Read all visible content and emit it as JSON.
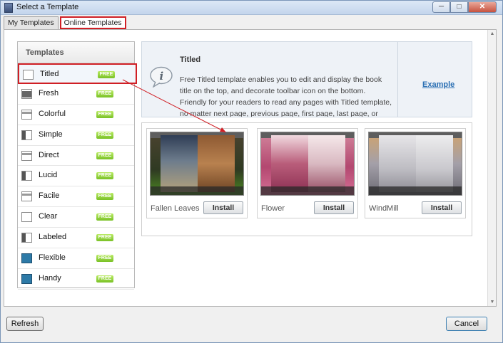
{
  "window": {
    "title": "Select a Template"
  },
  "window_controls": {
    "minimize": "─",
    "maximize": "□",
    "close": "✕"
  },
  "tabs": [
    {
      "label": "My Templates",
      "active": false
    },
    {
      "label": "Online Templates",
      "active": true
    }
  ],
  "sidebar": {
    "header": "Templates",
    "badge": "FREE",
    "items": [
      {
        "label": "Titled",
        "icon": "layout-icon",
        "selected": true
      },
      {
        "label": "Fresh",
        "icon": "layout-icon"
      },
      {
        "label": "Colorful",
        "icon": "layout-icon"
      },
      {
        "label": "Simple",
        "icon": "layout-icon"
      },
      {
        "label": "Direct",
        "icon": "layout-icon"
      },
      {
        "label": "Lucid",
        "icon": "layout-icon"
      },
      {
        "label": "Facile",
        "icon": "layout-icon"
      },
      {
        "label": "Clear",
        "icon": "layout-icon"
      },
      {
        "label": "Labeled",
        "icon": "layout-icon"
      },
      {
        "label": "Flexible",
        "icon": "layout-icon"
      },
      {
        "label": "Handy",
        "icon": "layout-icon"
      }
    ]
  },
  "info": {
    "title": "Titled",
    "description": "Free Titled template enables you to edit and display the book title on the top, and decorate toolbar icon on the bottom. Friendly for your readers to read any pages with Titled template, no matter next page, previous page, first page, last page, or specified page.",
    "example_link": "Example",
    "icon": "info-bubble-icon"
  },
  "templates": [
    {
      "name": "Fallen Leaves",
      "install_label": "Install"
    },
    {
      "name": "Flower",
      "install_label": "Install"
    },
    {
      "name": "WindMill",
      "install_label": "Install"
    }
  ],
  "buttons": {
    "refresh": "Refresh",
    "cancel": "Cancel"
  },
  "colors": {
    "highlight": "#d01f25",
    "link": "#2a6fb3",
    "badge": "#79c126"
  }
}
